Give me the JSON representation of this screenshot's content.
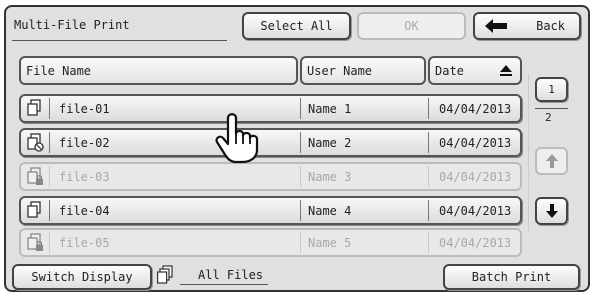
{
  "title": "Multi-File Print",
  "toolbar": {
    "select_all": "Select All",
    "ok": "OK",
    "back": "Back"
  },
  "columns": {
    "file_name": "File Name",
    "user_name": "User Name",
    "date": "Date"
  },
  "rows": [
    {
      "file": "file-01",
      "user": "Name 1",
      "date": "04/04/2013",
      "enabled": true,
      "icon": "document-icon"
    },
    {
      "file": "file-02",
      "user": "Name 2",
      "date": "04/04/2013",
      "enabled": true,
      "icon": "document-blocked-icon"
    },
    {
      "file": "file-03",
      "user": "Name 3",
      "date": "04/04/2013",
      "enabled": false,
      "icon": "document-locked-icon"
    },
    {
      "file": "file-04",
      "user": "Name 4",
      "date": "04/04/2013",
      "enabled": true,
      "icon": "document-icon"
    },
    {
      "file": "file-05",
      "user": "Name 5",
      "date": "04/04/2013",
      "enabled": false,
      "icon": "document-locked-icon"
    }
  ],
  "pagination": {
    "current": "1",
    "total": "2"
  },
  "footer": {
    "switch_display": "Switch Display",
    "display_mode": "All Files",
    "batch_print": "Batch Print"
  }
}
